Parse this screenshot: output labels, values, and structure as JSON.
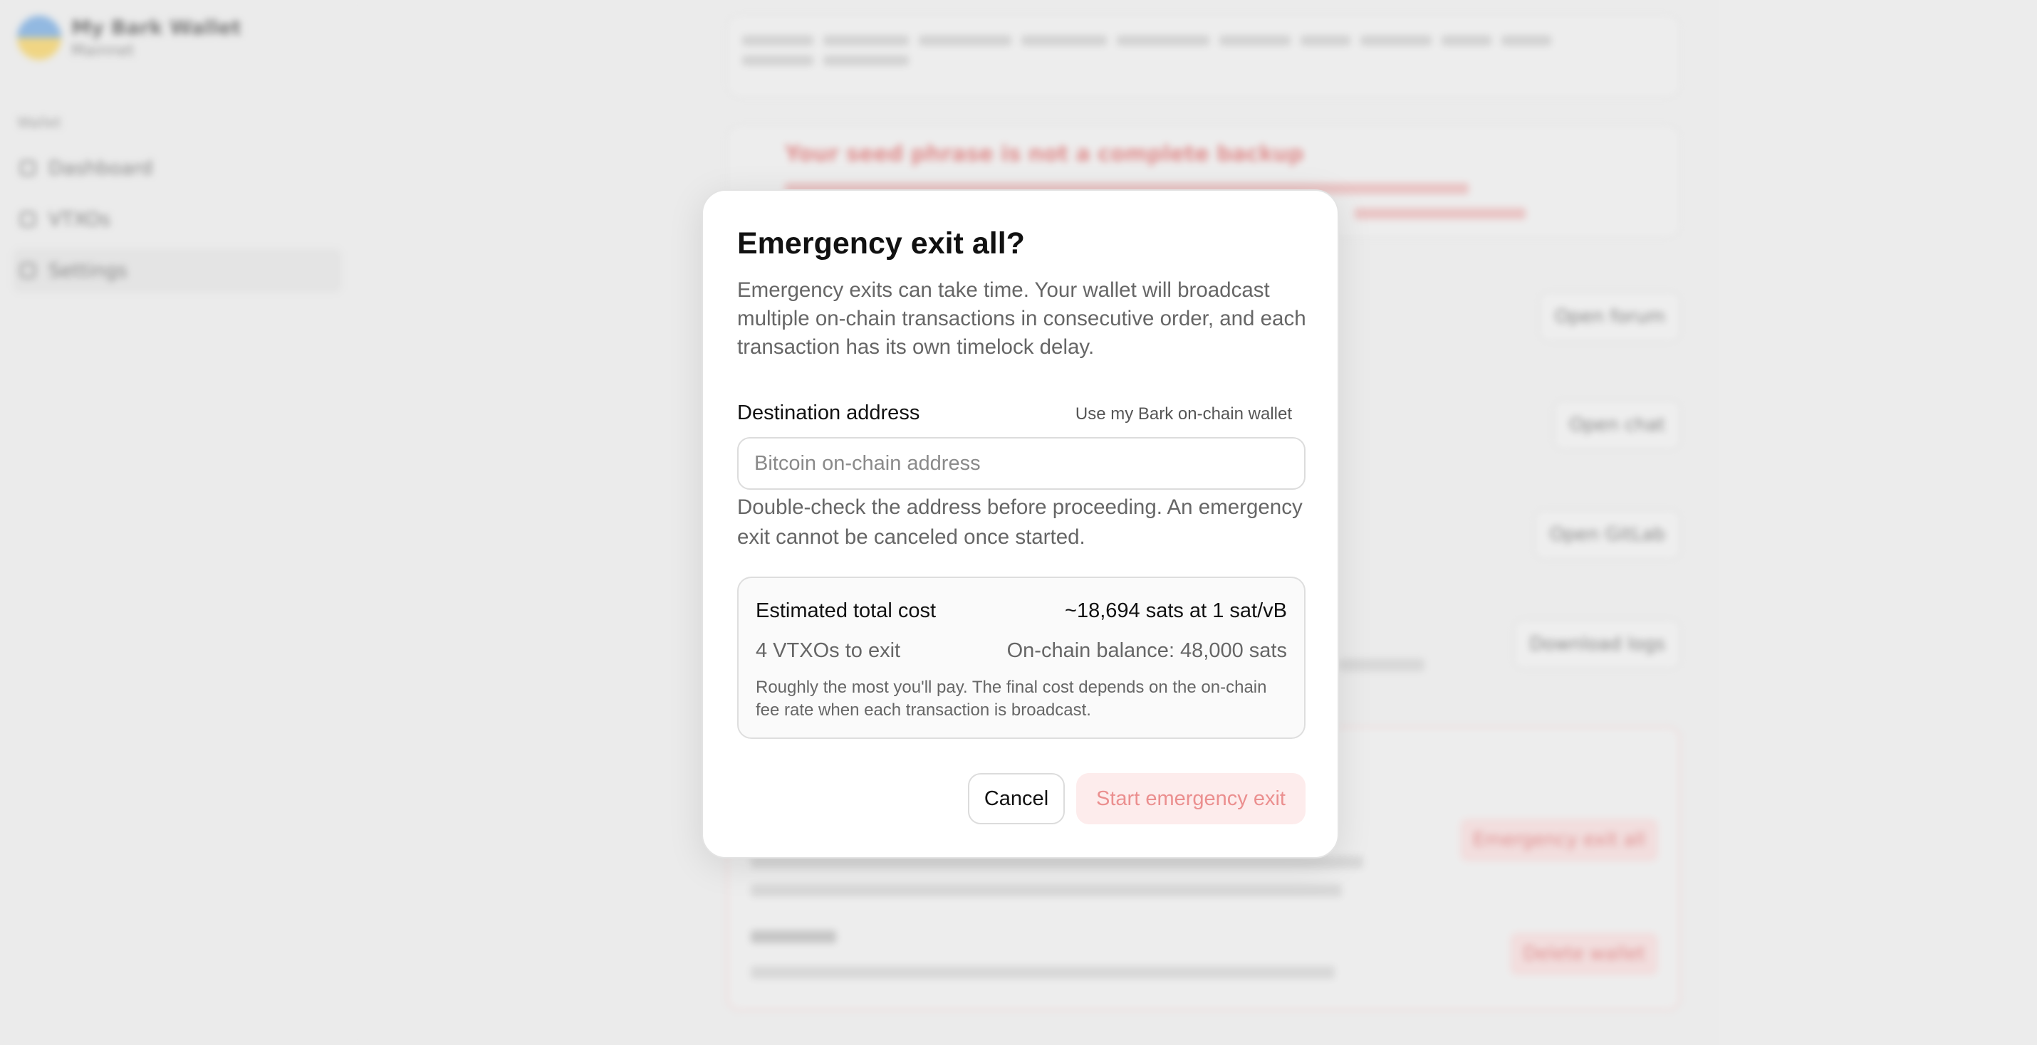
{
  "sidebar": {
    "wallet_name": "My Bark Wallet",
    "wallet_network": "Mainnet",
    "section_label": "Wallet",
    "items": [
      {
        "label": "Dashboard"
      },
      {
        "label": "VTXOs"
      },
      {
        "label": "Settings"
      }
    ]
  },
  "background": {
    "warning_title": "Your seed phrase is not a complete backup",
    "buttons": {
      "forum": "Open forum",
      "chat": "Open chat",
      "gitlab": "Open GitLab",
      "logs": "Download logs",
      "emergency_exit_all": "Emergency exit all",
      "delete_wallet": "Delete wallet"
    },
    "delete_title": "Delete wallet"
  },
  "dialog": {
    "title": "Emergency exit all?",
    "description": "Emergency exits can take time. Your wallet will broadcast multiple on-chain transactions in consecutive order, and each transaction has its own timelock delay.",
    "destination_label": "Destination address",
    "use_wallet_link": "Use my Bark on-chain wallet",
    "address_placeholder": "Bitcoin on-chain address",
    "address_value": "",
    "address_hint": "Double-check the address before proceeding. An emergency exit cannot be canceled once started.",
    "cost": {
      "label": "Estimated total cost",
      "value": "~18,694 sats at 1 sat/vB",
      "vtxos": "4 VTXOs to exit",
      "balance": "On-chain balance: 48,000 sats",
      "note": "Roughly the most you'll pay. The final cost depends on the on-chain fee rate when each transaction is broadcast."
    },
    "cancel_label": "Cancel",
    "start_label": "Start emergency exit"
  }
}
